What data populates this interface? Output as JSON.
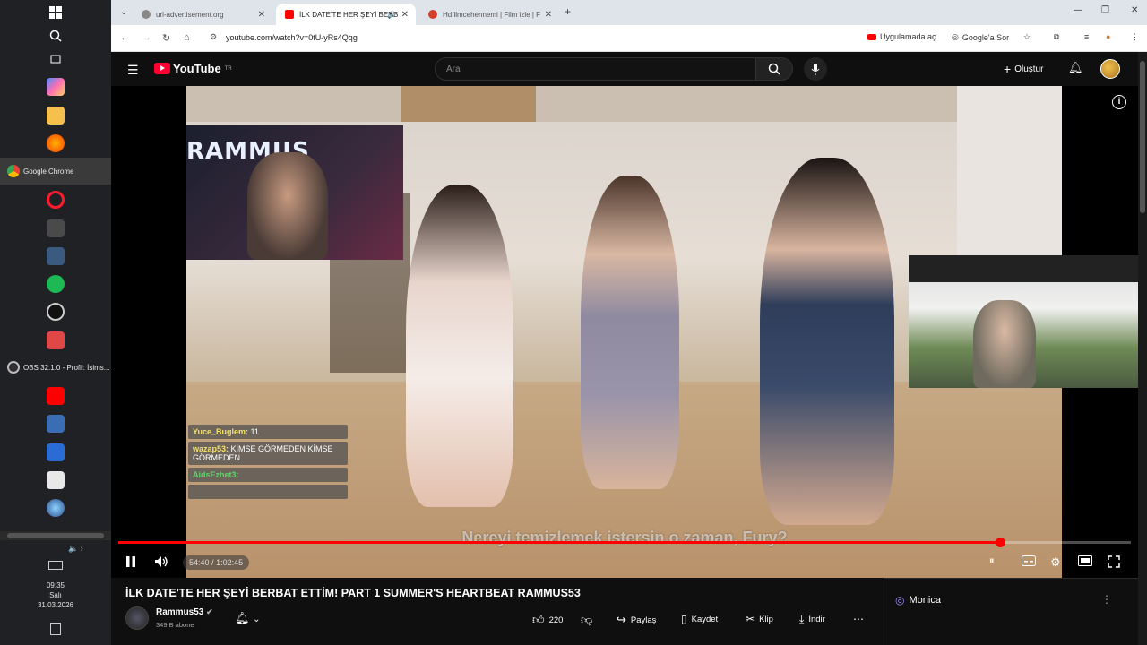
{
  "taskbar": {
    "apps": [
      {
        "label": "Google Chrome",
        "color": "#4285f4"
      },
      {
        "label": "OBS 32.1.0 - Profil: İsims...",
        "color": "#302e31"
      }
    ],
    "clock": {
      "time": "09:35",
      "day": "Salı",
      "date": "31.03.2026"
    }
  },
  "browser": {
    "tabs": [
      {
        "title": "url-advertisement.org",
        "active": false
      },
      {
        "title": "İLK DATE'TE HER ŞEYİ BERB",
        "active": true
      },
      {
        "title": "Hdfilmcehennemi | Film izle | F",
        "active": false
      }
    ],
    "url": "youtube.com/watch?v=0tU-yRs4Qqg",
    "open_in_app_label": "Uygulamada aç",
    "ask_google_label": "Google'a Sor"
  },
  "youtube": {
    "logo_text": "YouTube",
    "logo_country": "TR",
    "search_placeholder": "Ara",
    "create_label": "Oluştur",
    "player": {
      "stream_brand": "RAMMUS",
      "subtitle": "Nereyi temizlemek istersin o zaman, Fury?",
      "time_current": "54:40",
      "time_total": "1:02:45",
      "progress_fraction": 0.871,
      "chat": [
        {
          "user": "Yuce_Buglem:",
          "message": "11",
          "user_color": "u1"
        },
        {
          "user": "wazap53:",
          "message": "KİMSE GÖRMEDEN KİMSE GÖRMEDEN",
          "user_color": "u1"
        },
        {
          "user": "AidsEzhet3:",
          "message": "",
          "user_color": "u3"
        }
      ]
    },
    "video_title": "İLK DATE'TE HER ŞEYİ BERBAT ETTİM! PART 1 SUMMER'S HEARTBEAT RAMMUS53",
    "channel": {
      "name": "Rammus53",
      "subscribers": "349 B abone"
    },
    "actions": {
      "likes": "220",
      "share": "Paylaş",
      "save": "Kaydet",
      "clip": "Klip",
      "download": "İndir"
    },
    "side_panel": {
      "label": "Monica"
    }
  }
}
